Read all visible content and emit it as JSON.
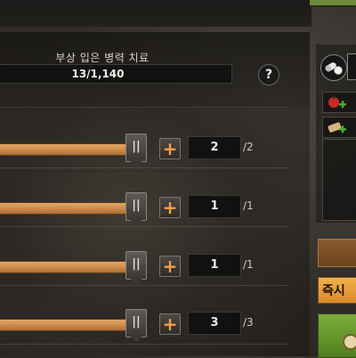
{
  "treatment": {
    "title": "부상 입은 병력 치료",
    "count": "13/1,140",
    "help_label": "?"
  },
  "rows": [
    {
      "quantity": "2",
      "max": "/2",
      "fill_fraction": 1.0
    },
    {
      "quantity": "1",
      "max": "/1",
      "fill_fraction": 1.0
    },
    {
      "quantity": "1",
      "max": "/1",
      "fill_fraction": 1.0
    },
    {
      "quantity": "3",
      "max": "/3",
      "fill_fraction": 1.0
    }
  ],
  "controls": {
    "plus_label": "+",
    "knob_label": "||"
  },
  "side": {
    "instant_label": "즉시"
  },
  "colors": {
    "slider_fill": "#d4954f",
    "plus_icon": "#f3a04a",
    "instant_button": "#e9a03d",
    "confirm_button": "#6a9a2e"
  },
  "icons": [
    "pills-icon",
    "apple-plus-icon",
    "scroll-plus-icon",
    "help-icon",
    "clock-icon"
  ]
}
